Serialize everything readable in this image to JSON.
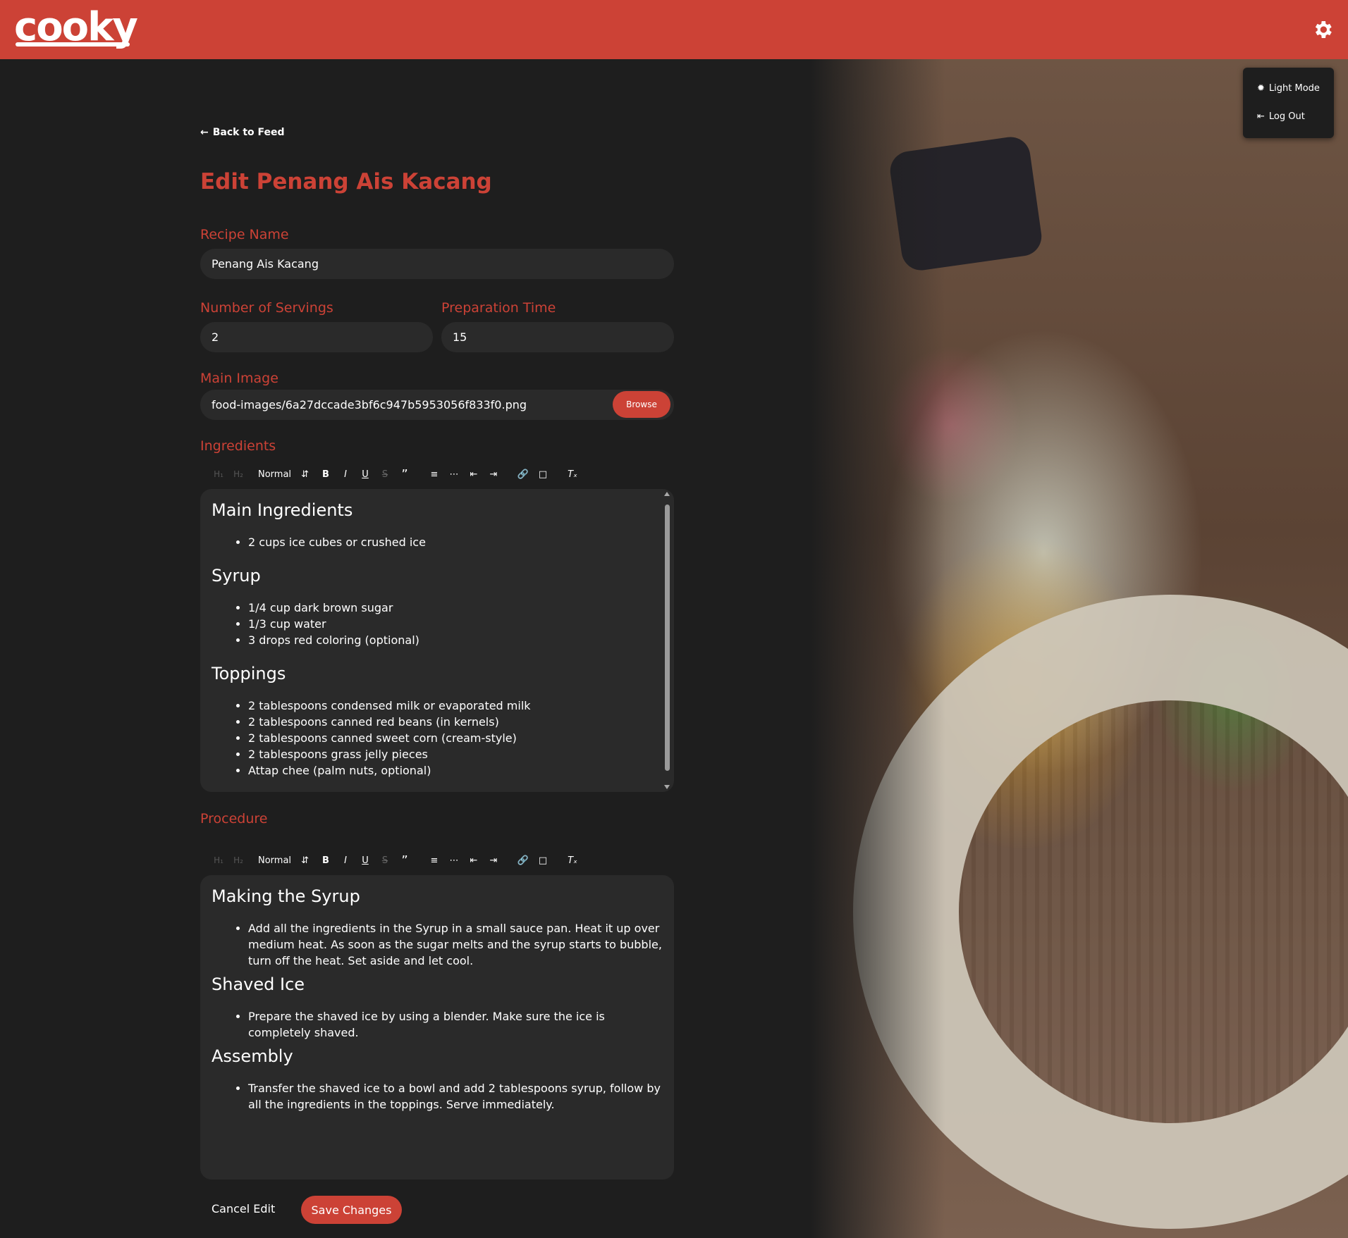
{
  "app": {
    "logo": "cooky"
  },
  "menu": {
    "light_mode": "Light Mode",
    "log_out": "Log Out"
  },
  "nav": {
    "back": "Back to Feed"
  },
  "page": {
    "title": "Edit Penang Ais Kacang"
  },
  "form": {
    "recipe_name_label": "Recipe Name",
    "recipe_name": "Penang Ais Kacang",
    "servings_label": "Number of Servings",
    "servings": "2",
    "prep_time_label": "Preparation Time",
    "prep_time": "15",
    "main_image_label": "Main Image",
    "main_image": "food-images/6a27dccade3bf6c947b5953056f833f0.png",
    "browse": "Browse",
    "ingredients_label": "Ingredients",
    "procedure_label": "Procedure"
  },
  "toolbar": {
    "h1": "H₁",
    "h2": "H₂",
    "format": "Normal",
    "bold": "B",
    "italic": "I",
    "underline": "U",
    "strike": "S",
    "quote": "”",
    "icons": [
      "ordered-list-icon",
      "bullet-list-icon",
      "outdent-icon",
      "indent-icon",
      "link-icon",
      "image-icon",
      "clear-format-icon"
    ]
  },
  "ingredients": {
    "h1": "Main Ingredients",
    "main": [
      "2 cups ice cubes or crushed ice"
    ],
    "h2": "Syrup",
    "syrup": [
      "1/4 cup dark brown sugar",
      "1/3 cup water",
      "3 drops red coloring (optional)"
    ],
    "h3": "Toppings",
    "toppings": [
      "2 tablespoons condensed milk or evaporated milk",
      "2 tablespoons canned red beans (in kernels)",
      "2 tablespoons canned sweet corn (cream-style)",
      "2 tablespoons grass jelly pieces",
      "Attap chee (palm nuts, optional)"
    ]
  },
  "procedure": {
    "h1": "Making the Syrup",
    "s1": "Add all the ingredients in the Syrup in a small sauce pan. Heat it up over medium heat. As soon as the sugar melts and the syrup starts to bubble, turn off the heat. Set aside and let cool.",
    "h2": "Shaved Ice",
    "s2": "Prepare the shaved ice by using a blender. Make sure the ice is completely shaved.",
    "h3": "Assembly",
    "s3": "Transfer the shaved ice to a bowl and add 2 tablespoons syrup, follow by all the ingredients in the toppings. Serve immediately."
  },
  "actions": {
    "cancel": "Cancel Edit",
    "save": "Save Changes"
  },
  "colors": {
    "brand": "#cc4236",
    "background": "#1e1e1e",
    "field": "#2a2a2a"
  }
}
